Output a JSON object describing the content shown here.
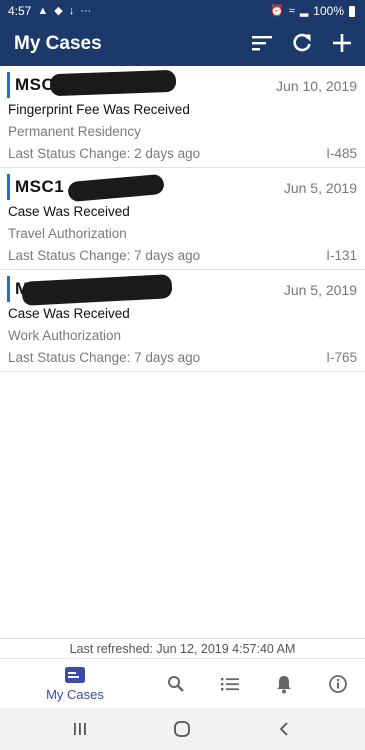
{
  "status_bar": {
    "time": "4:57",
    "extra": "···",
    "battery": "100%"
  },
  "header": {
    "title": "My Cases",
    "actions": [
      "sort-icon",
      "refresh-icon",
      "add-icon"
    ]
  },
  "cases": [
    {
      "id": "MSC",
      "date": "Jun 10, 2019",
      "status": "Fingerprint Fee Was Received",
      "type": "Permanent Residency",
      "last_change": "Last Status Change: 2 days ago",
      "form": "I-485"
    },
    {
      "id": "MSC1",
      "date": "Jun 5, 2019",
      "status": "Case Was Received",
      "type": "Travel Authorization",
      "last_change": "Last Status Change: 7 days ago",
      "form": "I-131"
    },
    {
      "id": "MS",
      "date": "Jun 5, 2019",
      "status": "Case Was Received",
      "type": "Work Authorization",
      "last_change": "Last Status Change: 7 days ago",
      "form": "I-765"
    }
  ],
  "refresh": "Last refreshed: Jun 12, 2019 4:57:40 AM",
  "bottom_nav": {
    "active_label": "My Cases",
    "items": [
      "my-cases-icon",
      "search-icon",
      "list-icon",
      "bell-icon",
      "info-icon"
    ]
  },
  "colors": {
    "primary": "#1b3a6b",
    "accent": "#1f74c2",
    "active_nav": "#3b4ba8"
  }
}
